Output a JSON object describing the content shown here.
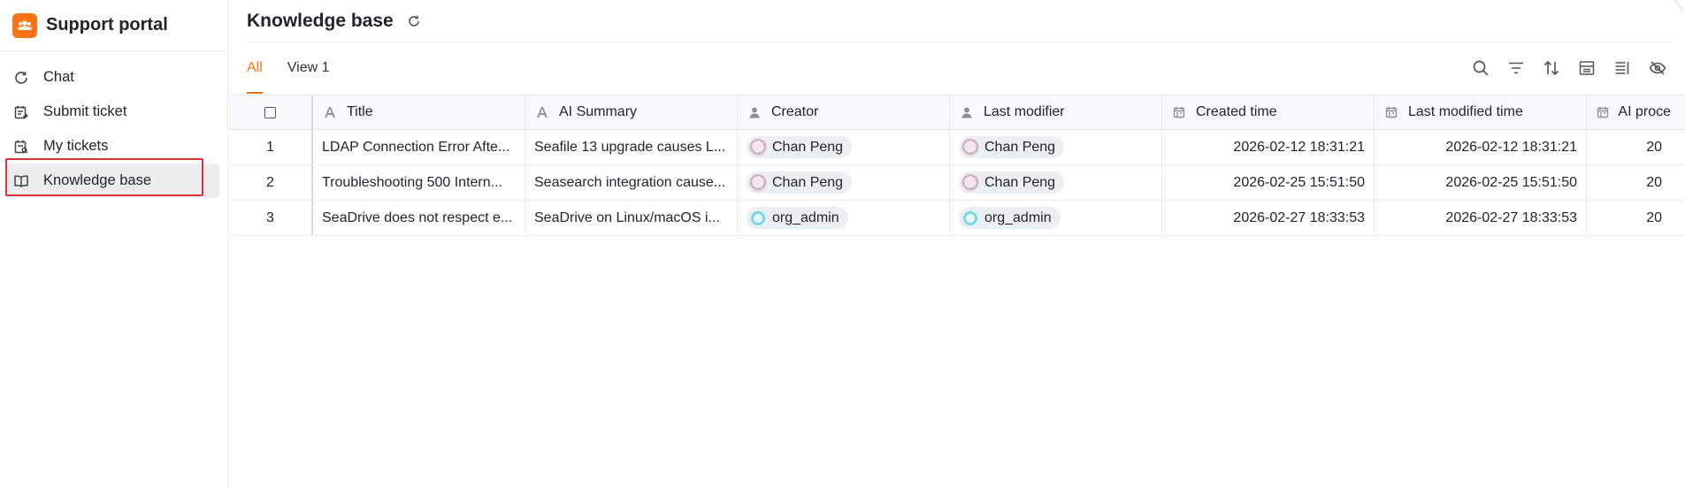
{
  "app": {
    "title": "Support portal"
  },
  "sidebar": {
    "items": [
      {
        "label": "Chat",
        "icon": "chat-refresh-icon"
      },
      {
        "label": "Submit ticket",
        "icon": "submit-ticket-icon"
      },
      {
        "label": "My tickets",
        "icon": "my-tickets-icon"
      },
      {
        "label": "Knowledge base",
        "icon": "book-icon",
        "active": true
      }
    ]
  },
  "header": {
    "title": "Knowledge base"
  },
  "views": [
    {
      "label": "All",
      "active": true
    },
    {
      "label": "View 1"
    }
  ],
  "columns": [
    {
      "label": "Title",
      "icon": "text-field-icon"
    },
    {
      "label": "AI Summary",
      "icon": "text-field-icon"
    },
    {
      "label": "Creator",
      "icon": "person-icon"
    },
    {
      "label": "Last modifier",
      "icon": "person-icon"
    },
    {
      "label": "Created time",
      "icon": "calendar-icon"
    },
    {
      "label": "Last modified time",
      "icon": "calendar-icon"
    },
    {
      "label": "AI proce",
      "icon": "calendar-icon"
    }
  ],
  "rows": [
    {
      "index": "1",
      "title": "LDAP Connection Error Afte...",
      "summary": "Seafile 13 upgrade causes L...",
      "creator": "Chan Peng",
      "modifier": "Chan Peng",
      "created": "2026-02-12 18:31:21",
      "modified": "2026-02-12 18:31:21",
      "ai": "20"
    },
    {
      "index": "2",
      "title": "Troubleshooting 500 Intern...",
      "summary": "Seasearch integration cause...",
      "creator": "Chan Peng",
      "modifier": "Chan Peng",
      "created": "2026-02-25 15:51:50",
      "modified": "2026-02-25 15:51:50",
      "ai": "20"
    },
    {
      "index": "3",
      "title": "SeaDrive does not respect e...",
      "summary": "SeaDrive on Linux/macOS i...",
      "creator": "org_admin",
      "modifier": "org_admin",
      "created": "2026-02-27 18:33:53",
      "modified": "2026-02-27 18:33:53",
      "ai": "20"
    }
  ],
  "colors": {
    "accent": "#f97316",
    "highlight_border": "#e0303c",
    "active_bg": "#ececec"
  }
}
